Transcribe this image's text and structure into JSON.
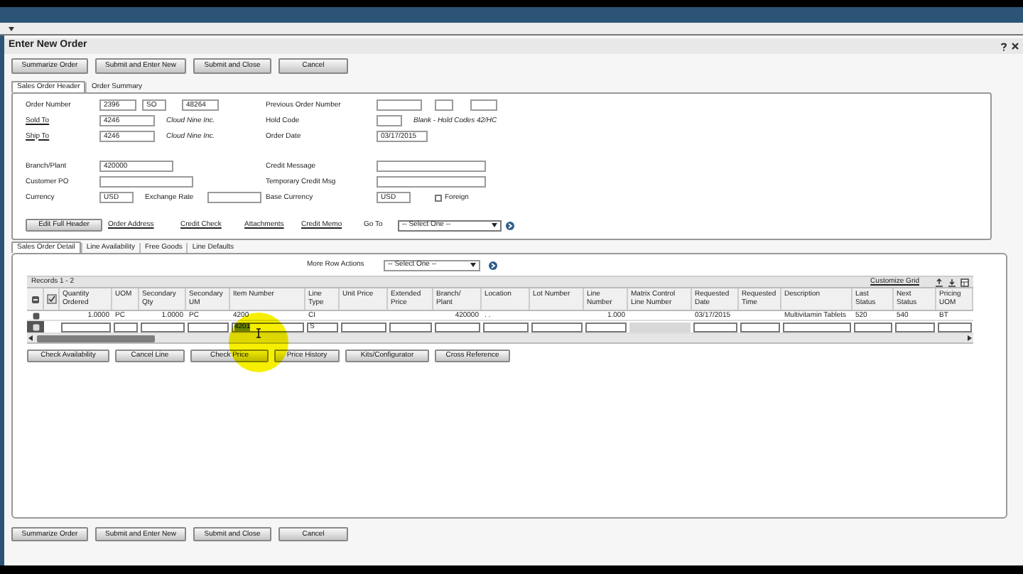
{
  "window": {
    "title": "Enter New Order"
  },
  "top_buttons": [
    "Summarize Order",
    "Submit and Enter New",
    "Submit and Close",
    "Cancel"
  ],
  "header_tabs": [
    {
      "label": "Sales Order Header",
      "selected": true
    },
    {
      "label": "Order Summary",
      "selected": false
    }
  ],
  "header_groups": [
    [
      {
        "left": [
          {
            "kind": "label",
            "text": "Order Number"
          },
          {
            "kind": "input",
            "value": "2396"
          },
          {
            "kind": "input",
            "value": "SO"
          },
          {
            "kind": "input",
            "value": "48264"
          }
        ],
        "right": [
          {
            "kind": "label",
            "text": "Previous Order Number"
          },
          {
            "kind": "input"
          },
          {
            "kind": "input"
          },
          {
            "kind": "input"
          }
        ]
      },
      {
        "left": [
          {
            "kind": "link",
            "text": "Sold To"
          },
          {
            "kind": "input",
            "value": "4246"
          },
          {
            "kind": "note",
            "text": "Cloud Nine Inc."
          }
        ],
        "right": [
          {
            "kind": "label",
            "text": "Hold Code"
          },
          {
            "kind": "input"
          },
          {
            "kind": "note",
            "text": "Blank - Hold Codes 42/HC"
          }
        ]
      },
      {
        "left": [
          {
            "kind": "link",
            "text": "Ship To"
          },
          {
            "kind": "input",
            "value": "4246"
          },
          {
            "kind": "note",
            "text": "Cloud Nine Inc."
          }
        ],
        "right": [
          {
            "kind": "label",
            "text": "Order Date"
          },
          {
            "kind": "input",
            "value": "03/17/2015"
          }
        ]
      }
    ],
    [
      {
        "left": [
          {
            "kind": "label",
            "text": "Branch/Plant"
          },
          {
            "kind": "input",
            "value": "420000"
          }
        ],
        "right": [
          {
            "kind": "label",
            "text": "Credit Message"
          },
          {
            "kind": "input"
          }
        ]
      },
      {
        "left": [
          {
            "kind": "label",
            "text": "Customer PO"
          },
          {
            "kind": "input"
          }
        ],
        "right": [
          {
            "kind": "label",
            "text": "Temporary Credit Msg"
          },
          {
            "kind": "input"
          }
        ]
      },
      {
        "left": [
          {
            "kind": "label",
            "text": "Currency"
          },
          {
            "kind": "input",
            "value": "USD"
          },
          {
            "kind": "label",
            "text": "Exchange Rate"
          },
          {
            "kind": "input"
          }
        ],
        "right": [
          {
            "kind": "label",
            "text": "Base Currency"
          },
          {
            "kind": "input",
            "value": "USD"
          },
          {
            "kind": "checkbox",
            "text": "Foreign",
            "checked": false
          }
        ]
      }
    ]
  ],
  "header_actions": {
    "button": "Edit Full Header",
    "links": [
      "Order Address",
      "Credit Check",
      "Attachments",
      "Credit Memo"
    ],
    "goto_label": "Go To",
    "goto_value": "-- Select One --"
  },
  "detail_tabs": [
    {
      "label": "Sales Order Detail",
      "selected": true
    },
    {
      "label": "Line Availability",
      "selected": false
    },
    {
      "label": "Free Goods",
      "selected": false
    },
    {
      "label": "Line Defaults",
      "selected": false
    }
  ],
  "row_actions": {
    "label": "More Row Actions",
    "value": "-- Select One --"
  },
  "grid": {
    "records": "Records 1 - 2",
    "customize": "Customize Grid",
    "columns": [
      "Quantity Ordered",
      "UOM",
      "Secondary Qty",
      "Secondary UM",
      "Item Number",
      "Line Type",
      "Unit Price",
      "Extended Price",
      "Branch/ Plant",
      "Location",
      "Lot Number",
      "Line Number",
      "Matrix Control Line Number",
      "Requested Date",
      "Requested Time",
      "Description",
      "Last Status",
      "Next Status",
      "Pricing UOM"
    ],
    "rows": [
      {
        "kind": "data",
        "selected": false,
        "cells": [
          {
            "value": "1.0000"
          },
          {
            "value": "PC"
          },
          {
            "value": "1.0000"
          },
          {
            "value": "PC"
          },
          {
            "value": "4200"
          },
          {
            "value": "CI"
          },
          {},
          {},
          {
            "value": "420000"
          },
          {
            "value": ". ."
          },
          {},
          {
            "value": "1.000"
          },
          {},
          {
            "value": "03/17/2015"
          },
          {},
          {
            "value": "Multivitamin Tablets"
          },
          {
            "value": "520"
          },
          {
            "value": "540"
          },
          {
            "value": "BT"
          }
        ]
      },
      {
        "kind": "input",
        "selected": true,
        "cells": [
          {},
          {},
          {},
          {},
          {
            "value": "4201",
            "selected": true
          },
          {
            "value": "S"
          },
          {},
          {},
          {},
          {},
          {},
          {},
          {
            "disabled": true
          },
          {},
          {},
          {},
          {},
          {},
          {}
        ]
      }
    ]
  },
  "grid_buttons": [
    "Check Availability",
    "Cancel Line",
    "Check Price",
    "Price History",
    "Kits/Configurator",
    "Cross Reference"
  ],
  "bottom_buttons": [
    "Summarize Order",
    "Submit and Enter New",
    "Submit and Close",
    "Cancel"
  ]
}
